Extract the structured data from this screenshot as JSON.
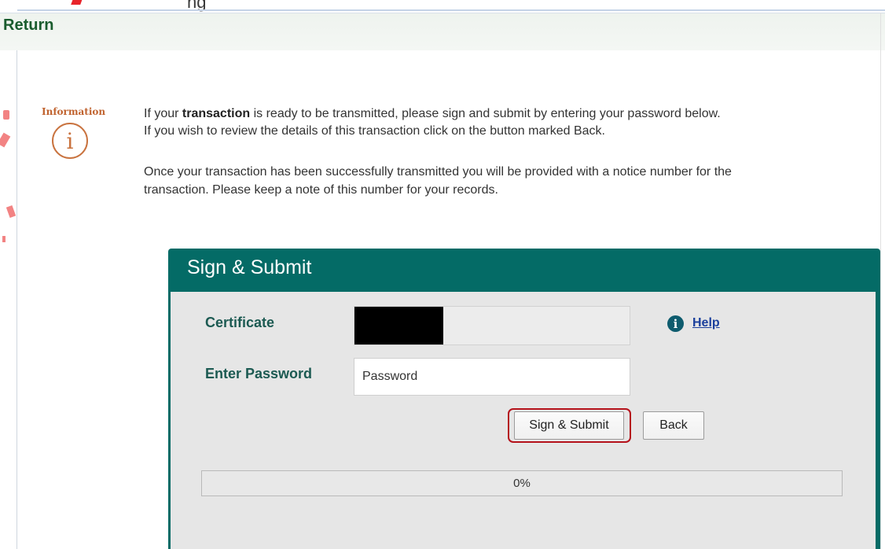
{
  "header": {
    "clipped_text": "ng",
    "return_label": "Return"
  },
  "info": {
    "label": "Information",
    "icon_glyph": "i",
    "icon": "information-circle-icon",
    "paragraph1_pre": "If your ",
    "paragraph1_bold": "transaction",
    "paragraph1_post": " is ready to be transmitted, please sign and submit by entering your password below.",
    "paragraph2": "If you wish to review the details of this transaction click on the button marked Back.",
    "paragraph3": "Once your transaction has been successfully transmitted you will be provided with a notice number for the",
    "paragraph4": "transaction. Please keep a note of this number for your records."
  },
  "panel": {
    "title": "Sign & Submit",
    "certificate_label": "Certificate",
    "certificate_value": "",
    "help_icon_glyph": "i",
    "help_icon": "info-filled-icon",
    "help_label": "Help",
    "password_label": "Enter Password",
    "password_placeholder": "Password",
    "password_value": "",
    "sign_submit_label": "Sign & Submit",
    "back_label": "Back",
    "progress": 0,
    "progress_text": "0%"
  },
  "colors": {
    "header_title": "#1a5c2e",
    "panel_header": "#046b66",
    "info_icon": "#c9733f",
    "highlight": "#b5121b",
    "link": "#1a3f9c"
  }
}
